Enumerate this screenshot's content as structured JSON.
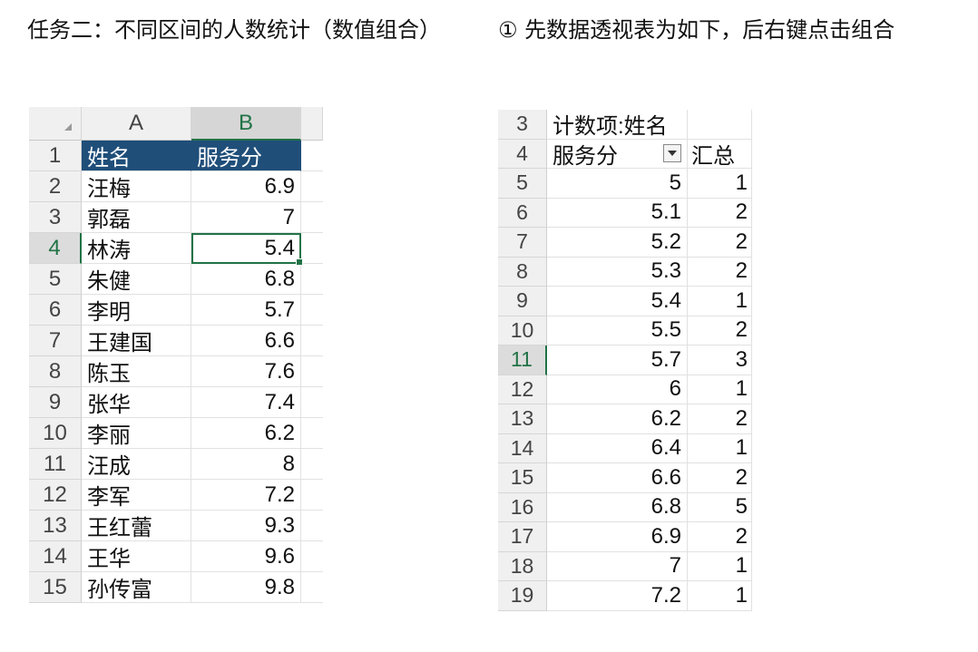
{
  "instructions": {
    "left": "任务二：不同区间的人数统计（数值组合）",
    "right": "① 先数据透视表为如下，后右键点击组合"
  },
  "left_sheet": {
    "select_all": "◢",
    "columns": [
      "A",
      "B"
    ],
    "selected_column": "B",
    "selected_cell": "B4",
    "rows": [
      {
        "row": "1",
        "name": "姓名",
        "score": "服务分",
        "header": true
      },
      {
        "row": "2",
        "name": "汪梅",
        "score": "6.9"
      },
      {
        "row": "3",
        "name": "郭磊",
        "score": "7"
      },
      {
        "row": "4",
        "name": "林涛",
        "score": "5.4"
      },
      {
        "row": "5",
        "name": "朱健",
        "score": "6.8"
      },
      {
        "row": "6",
        "name": "李明",
        "score": "5.7"
      },
      {
        "row": "7",
        "name": "王建国",
        "score": "6.6"
      },
      {
        "row": "8",
        "name": "陈玉",
        "score": "7.6"
      },
      {
        "row": "9",
        "name": "张华",
        "score": "7.4"
      },
      {
        "row": "10",
        "name": "李丽",
        "score": "6.2"
      },
      {
        "row": "11",
        "name": "汪成",
        "score": "8"
      },
      {
        "row": "12",
        "name": "李军",
        "score": "7.2"
      },
      {
        "row": "13",
        "name": "王红蕾",
        "score": "9.3"
      },
      {
        "row": "14",
        "name": "王华",
        "score": "9.6"
      },
      {
        "row": "15",
        "name": "孙传富",
        "score": "9.8"
      }
    ]
  },
  "pivot_sheet": {
    "header_rows": [
      {
        "row": "3",
        "a": "计数项:姓名",
        "b": ""
      },
      {
        "row": "4",
        "a": "服务分",
        "b": "汇总",
        "dropdown": true
      }
    ],
    "active_row": "11",
    "rows": [
      {
        "row": "5",
        "value": "5",
        "count": "1"
      },
      {
        "row": "6",
        "value": "5.1",
        "count": "2"
      },
      {
        "row": "7",
        "value": "5.2",
        "count": "2"
      },
      {
        "row": "8",
        "value": "5.3",
        "count": "2"
      },
      {
        "row": "9",
        "value": "5.4",
        "count": "1"
      },
      {
        "row": "10",
        "value": "5.5",
        "count": "2"
      },
      {
        "row": "11",
        "value": "5.7",
        "count": "3"
      },
      {
        "row": "12",
        "value": "6",
        "count": "1"
      },
      {
        "row": "13",
        "value": "6.2",
        "count": "2"
      },
      {
        "row": "14",
        "value": "6.4",
        "count": "1"
      },
      {
        "row": "15",
        "value": "6.6",
        "count": "2"
      },
      {
        "row": "16",
        "value": "6.8",
        "count": "5"
      },
      {
        "row": "17",
        "value": "6.9",
        "count": "2"
      },
      {
        "row": "18",
        "value": "7",
        "count": "1"
      },
      {
        "row": "19",
        "value": "7.2",
        "count": "1"
      }
    ]
  },
  "colors": {
    "table_header": "#1f4e79",
    "selection": "#217346"
  }
}
